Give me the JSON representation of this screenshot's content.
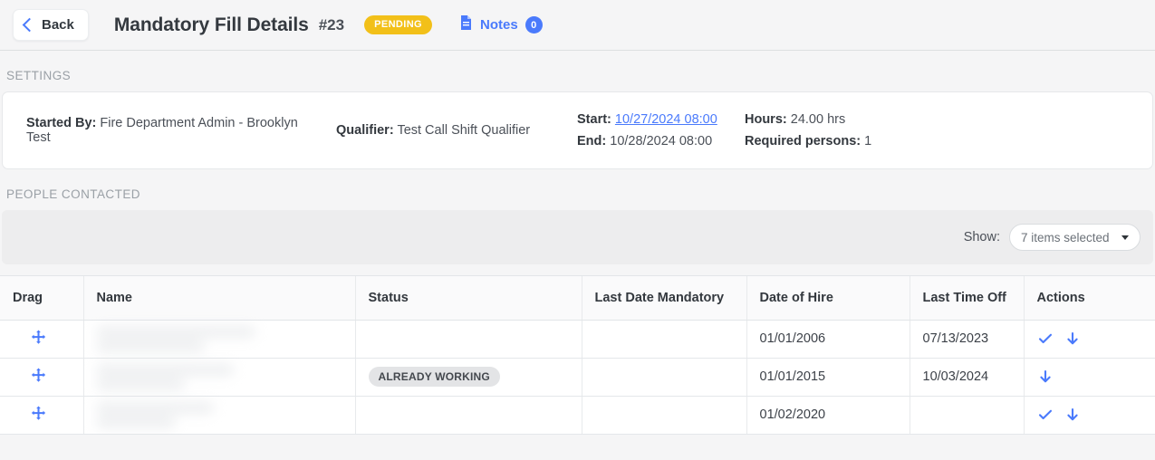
{
  "header": {
    "back_label": "Back",
    "title": "Mandatory Fill Details",
    "record_number": "#23",
    "status": "PENDING",
    "notes_label": "Notes",
    "notes_count": "0",
    "status_color": "#f2c019",
    "accent_color": "#4a7afc"
  },
  "settings": {
    "section_label": "SETTINGS",
    "started_by_key": "Started By:",
    "started_by_value": "Fire Department Admin - Brooklyn Test",
    "qualifier_key": "Qualifier:",
    "qualifier_value": "Test Call Shift Qualifier",
    "start_key": "Start:",
    "start_value": "10/27/2024 08:00",
    "end_key": "End:",
    "end_value": "10/28/2024 08:00",
    "hours_key": "Hours:",
    "hours_value": "24.00 hrs",
    "required_key": "Required persons:",
    "required_value": "1"
  },
  "people": {
    "section_label": "PEOPLE CONTACTED",
    "show_label": "Show:",
    "show_value": "7 items selected"
  },
  "table": {
    "columns": [
      "Drag",
      "Name",
      "Status",
      "Last Date Mandatory",
      "Date of Hire",
      "Last Time Off",
      "Actions"
    ],
    "rows": [
      {
        "name": "",
        "status": "",
        "last_date_mandatory": "",
        "date_of_hire": "01/01/2006",
        "last_time_off": "07/13/2023",
        "actions": [
          "check-icon",
          "down-arrow-icon"
        ]
      },
      {
        "name": "",
        "status": "ALREADY WORKING",
        "last_date_mandatory": "",
        "date_of_hire": "01/01/2015",
        "last_time_off": "10/03/2024",
        "actions": [
          "down-arrow-icon"
        ]
      },
      {
        "name": "",
        "status": "",
        "last_date_mandatory": "",
        "date_of_hire": "01/02/2020",
        "last_time_off": "",
        "actions": [
          "check-icon",
          "down-arrow-icon"
        ]
      }
    ]
  }
}
